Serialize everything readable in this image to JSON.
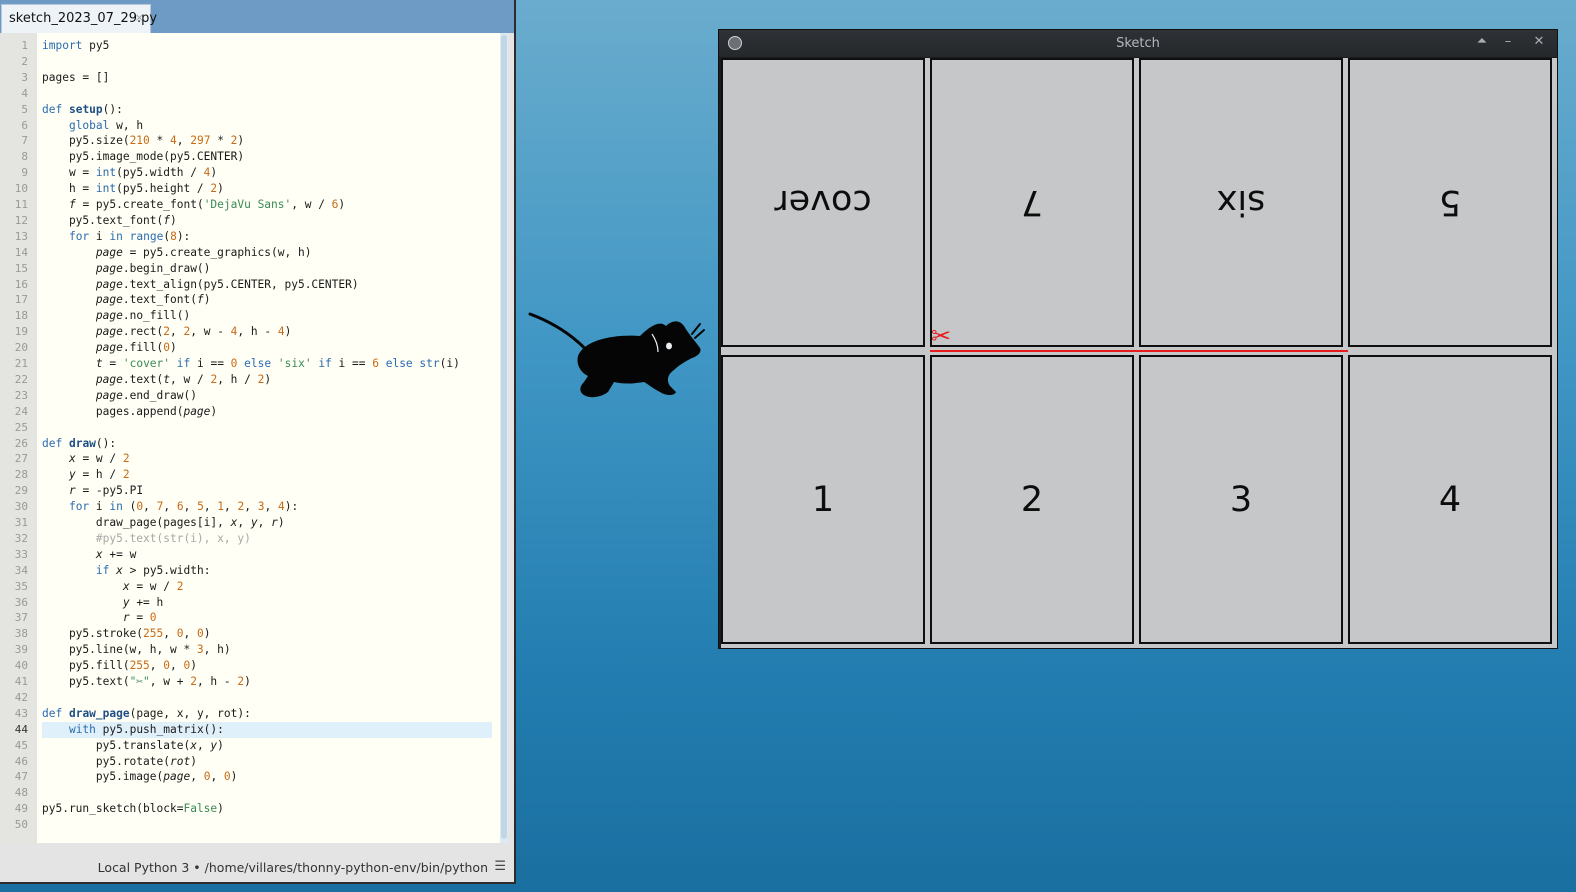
{
  "editor": {
    "tab_title": "sketch_2023_07_29.py",
    "tab_close": "×",
    "current_line": 44,
    "code_lines": [
      "import py5",
      "",
      "pages = []",
      "",
      "def setup():",
      "    global w, h",
      "    py5.size(210 * 4, 297 * 2)",
      "    py5.image_mode(py5.CENTER)",
      "    w = int(py5.width / 4)",
      "    h = int(py5.height / 2)",
      "    f = py5.create_font('DejaVu Sans', w / 6)",
      "    py5.text_font(f)",
      "    for i in range(8):",
      "        page = py5.create_graphics(w, h)",
      "        page.begin_draw()",
      "        page.text_align(py5.CENTER, py5.CENTER)",
      "        page.text_font(f)",
      "        page.no_fill()",
      "        page.rect(2, 2, w - 4, h - 4)",
      "        page.fill(0)",
      "        t = 'cover' if i == 0 else 'six' if i == 6 else str(i)",
      "        page.text(t, w / 2, h / 2)",
      "        page.end_draw()",
      "        pages.append(page)",
      "",
      "def draw():",
      "    x = w / 2",
      "    y = h / 2",
      "    r = -py5.PI",
      "    for i in (0, 7, 6, 5, 1, 2, 3, 4):",
      "        draw_page(pages[i], x, y, r)",
      "        #py5.text(str(i), x, y)",
      "        x += w",
      "        if x > py5.width:",
      "            x = w / 2",
      "            y += h",
      "            r = 0",
      "    py5.stroke(255, 0, 0)",
      "    py5.line(w, h, w * 3, h)",
      "    py5.fill(255, 0, 0)",
      "    py5.text(\"✂\", w + 2, h - 2)",
      "",
      "def draw_page(page, x, y, rot):",
      "    with py5.push_matrix():",
      "        py5.translate(x, y)",
      "        py5.rotate(rot)",
      "        py5.image(page, 0, 0)",
      "",
      "py5.run_sketch(block=False)",
      ""
    ],
    "status": {
      "interpreter": "Local Python 3",
      "separator": "•",
      "path": "/home/villares/thonny-python-env/bin/python",
      "menu_icon": "☰"
    }
  },
  "sketch_window": {
    "title": "Sketch",
    "buttons": {
      "keep_above": "⏶",
      "minimize": "–",
      "close": "✕"
    },
    "top_row_labels": [
      "cover",
      "7",
      "six",
      "5"
    ],
    "bottom_row_labels": [
      "1",
      "2",
      "3",
      "4"
    ],
    "scissors": "✂",
    "cut_color": "#e81c1c"
  },
  "desktop": {
    "logo": "xfce-mouse-icon"
  }
}
